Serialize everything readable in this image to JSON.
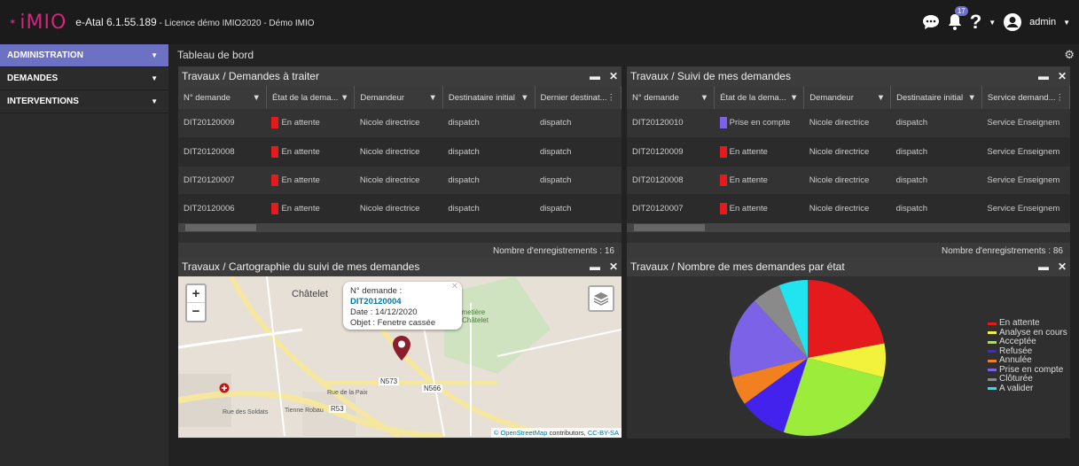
{
  "app": {
    "brand": "iMIO",
    "title": "e-Atal 6.1.55.189",
    "subtitle": " - Licence démo IMIO2020 - Démo IMIO",
    "notifications": "17",
    "user": "admin"
  },
  "sidebar": {
    "items": [
      {
        "label": "ADMINISTRATION"
      },
      {
        "label": "DEMANDES"
      },
      {
        "label": "INTERVENTIONS"
      }
    ]
  },
  "main": {
    "title": "Tableau de bord"
  },
  "panel1": {
    "title": "Travaux / Demandes à traiter",
    "columns": [
      "N° demande",
      "État de la dema...",
      "Demandeur",
      "Destinataire initial",
      "Dernier destinat..."
    ],
    "rows": [
      [
        "DIT20120009",
        "En attente",
        "Nicole directrice",
        "dispatch",
        "dispatch"
      ],
      [
        "DIT20120008",
        "En attente",
        "Nicole directrice",
        "dispatch",
        "dispatch"
      ],
      [
        "DIT20120007",
        "En attente",
        "Nicole directrice",
        "dispatch",
        "dispatch"
      ],
      [
        "DIT20120006",
        "En attente",
        "Nicole directrice",
        "dispatch",
        "dispatch"
      ]
    ],
    "footer": "Nombre d'enregistrements : 16"
  },
  "panel2": {
    "title": "Travaux / Suivi de mes demandes",
    "columns": [
      "N° demande",
      "État de la dema...",
      "Demandeur",
      "Destinataire initial",
      "Service demand..."
    ],
    "rows": [
      [
        "DIT20120010",
        "Prise en compte",
        "Nicole directrice",
        "dispatch",
        "Service Enseignem"
      ],
      [
        "DIT20120009",
        "En attente",
        "Nicole directrice",
        "dispatch",
        "Service Enseignem"
      ],
      [
        "DIT20120008",
        "En attente",
        "Nicole directrice",
        "dispatch",
        "Service Enseignem"
      ],
      [
        "DIT20120007",
        "En attente",
        "Nicole directrice",
        "dispatch",
        "Service Enseignem"
      ]
    ],
    "footer": "Nombre d'enregistrements : 86"
  },
  "panel3": {
    "title": "Travaux / Cartographie du suivi de mes demandes",
    "popup": {
      "label1": "N° demande : ",
      "id": "DIT20120004",
      "date": "Date : 14/12/2020",
      "objet": "Objet : Fenetre cassée"
    },
    "labels": {
      "city": "Châtelet",
      "cemetery1": "Cimetière",
      "cemetery2": "de Châtelet",
      "road1": "N573",
      "road2": "N566",
      "road3": "R53",
      "street1": "Rue des Soldats",
      "street2": "Tienne Robau",
      "street3": "Rue de la Paix"
    },
    "attrib1": "© OpenStreetMap",
    "attrib2": " contributors, ",
    "attrib3": "CC-BY-SA",
    "zoom_in": "+",
    "zoom_out": "−"
  },
  "panel4": {
    "title": "Travaux / Nombre de mes demandes par état",
    "legend": [
      "En attente",
      "Analyse en cours",
      "Acceptée",
      "Refusée",
      "Annulée",
      "Prise en compte",
      "Clôturée",
      "A valider"
    ]
  },
  "chart_data": {
    "type": "pie",
    "categories": [
      "En attente",
      "Analyse en cours",
      "Acceptée",
      "Refusée",
      "Annulée",
      "Prise en compte",
      "Clôturée",
      "A valider"
    ],
    "values": [
      22,
      7,
      26,
      10,
      6,
      17,
      6,
      6
    ],
    "colors": [
      "#e41a1c",
      "#f2f23c",
      "#9cec3c",
      "#4422ee",
      "#f08020",
      "#7b62e6",
      "#8a8a8a",
      "#22e4f0"
    ],
    "legend_position": "right"
  },
  "colors": {
    "accent": "#6c71c4",
    "attente": "#e41a1c",
    "prise": "#7b62e6"
  }
}
